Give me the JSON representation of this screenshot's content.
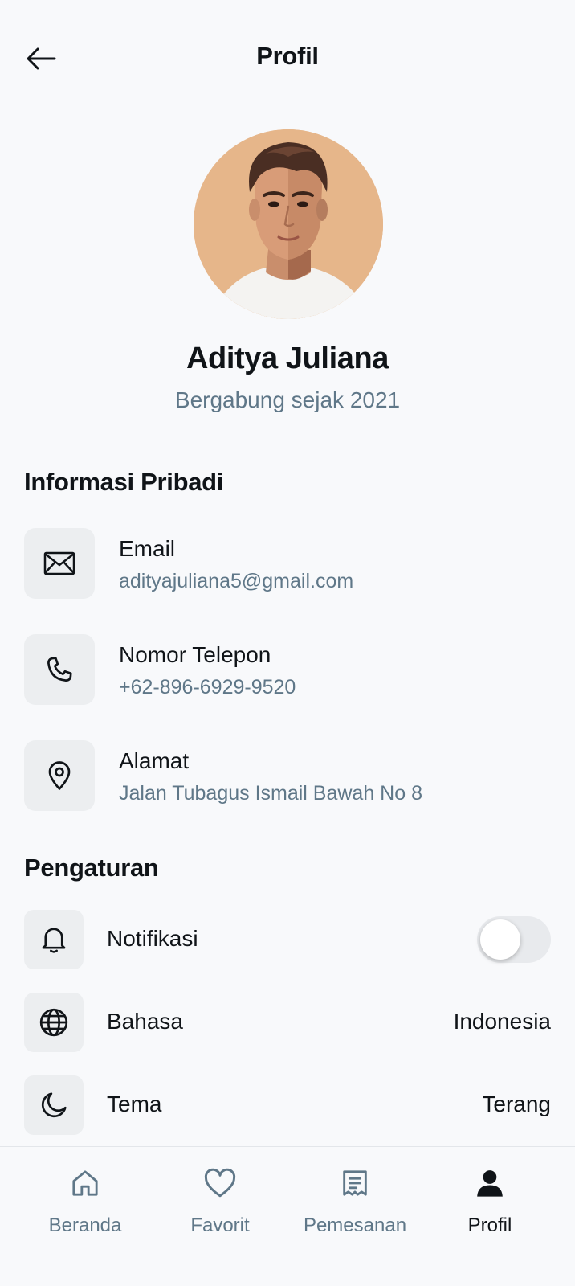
{
  "header": {
    "title": "Profil"
  },
  "profile": {
    "name": "Aditya Juliana",
    "since": "Bergabung sejak 2021"
  },
  "personal": {
    "title": "Informasi Pribadi",
    "items": [
      {
        "label": "Email",
        "value": "adityajuliana5@gmail.com",
        "icon": "mail-icon"
      },
      {
        "label": "Nomor Telepon",
        "value": "+62-896-6929-9520",
        "icon": "phone-icon"
      },
      {
        "label": "Alamat",
        "value": "Jalan Tubagus Ismail Bawah No 8",
        "icon": "location-pin-icon"
      }
    ]
  },
  "settings": {
    "title": "Pengaturan",
    "items": [
      {
        "label": "Notifikasi",
        "icon": "bell-icon",
        "toggle": false
      },
      {
        "label": "Bahasa",
        "value": "Indonesia",
        "icon": "globe-icon"
      },
      {
        "label": "Tema",
        "value": "Terang",
        "icon": "moon-icon"
      }
    ]
  },
  "nav": {
    "items": [
      {
        "label": "Beranda",
        "icon": "home-icon",
        "active": false
      },
      {
        "label": "Favorit",
        "icon": "heart-icon",
        "active": false
      },
      {
        "label": "Pemesanan",
        "icon": "receipt-icon",
        "active": false
      },
      {
        "label": "Profil",
        "icon": "user-icon",
        "active": true
      }
    ]
  },
  "colors": {
    "background": "#f8f9fb",
    "muted_text": "#5f7788",
    "icon_tile": "#eceef0",
    "avatar_bg": "#e6b68a"
  }
}
